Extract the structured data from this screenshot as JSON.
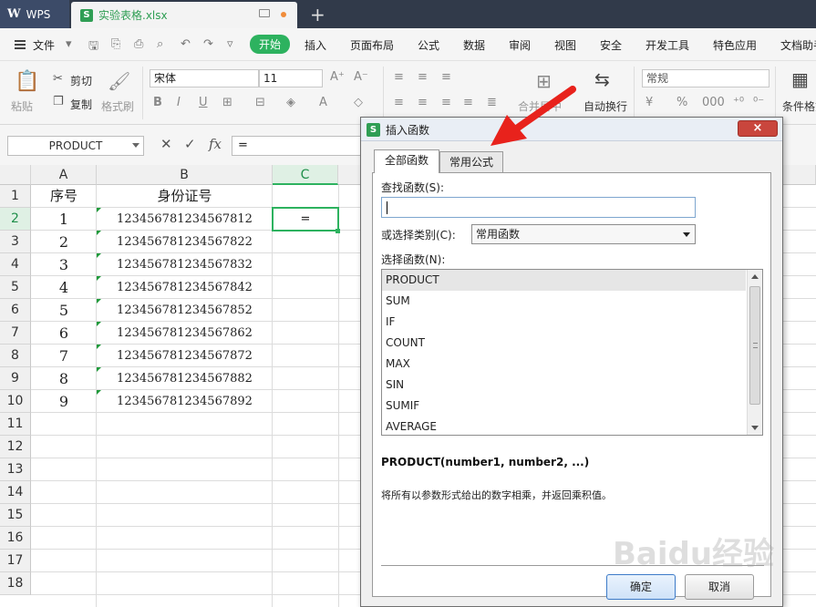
{
  "titlebar": {
    "app_name": "WPS",
    "doc_icon": "S",
    "doc_name": "实验表格.xlsx",
    "new_tab": "+"
  },
  "menubar": {
    "file": "文件",
    "tabs": [
      "开始",
      "插入",
      "页面布局",
      "公式",
      "数据",
      "审阅",
      "视图",
      "安全",
      "开发工具",
      "特色应用",
      "文档助手"
    ],
    "active_tab": "开始"
  },
  "ribbon": {
    "paste": "粘贴",
    "cut": "剪切",
    "copy": "复制",
    "format_painter": "格式刷",
    "font_name": "宋体",
    "font_size": "11",
    "wrap_text": "自动换行",
    "merge_center": "合并居中",
    "number_format": "常规",
    "conditional_format": "条件格式"
  },
  "formula_bar": {
    "name_box": "PRODUCT",
    "fx": "fx",
    "formula": "="
  },
  "sheet": {
    "columns": [
      "A",
      "B",
      "C"
    ],
    "row_numbers": [
      "1",
      "2",
      "3",
      "4",
      "5",
      "6",
      "7",
      "8",
      "9",
      "10",
      "11",
      "12",
      "13",
      "14",
      "15",
      "16",
      "17",
      "18"
    ],
    "header": [
      "序号",
      "身份证号"
    ],
    "rows": [
      [
        "1",
        "123456781234567812"
      ],
      [
        "2",
        "123456781234567822"
      ],
      [
        "3",
        "123456781234567832"
      ],
      [
        "4",
        "123456781234567842"
      ],
      [
        "5",
        "123456781234567852"
      ],
      [
        "6",
        "123456781234567862"
      ],
      [
        "7",
        "123456781234567872"
      ],
      [
        "8",
        "123456781234567882"
      ],
      [
        "9",
        "123456781234567892"
      ]
    ],
    "active_cell_value": "="
  },
  "dialog": {
    "icon": "S",
    "title": "插入函数",
    "close": "×",
    "tabs": [
      "全部函数",
      "常用公式"
    ],
    "search_label": "查找函数(S):",
    "category_label": "或选择类别(C):",
    "category_value": "常用函数",
    "func_label": "选择函数(N):",
    "functions": [
      "PRODUCT",
      "SUM",
      "IF",
      "COUNT",
      "MAX",
      "SIN",
      "SUMIF",
      "AVERAGE"
    ],
    "signature": "PRODUCT(number1, number2, ...)",
    "description": "将所有以参数形式给出的数字相乘，并返回乘积值。",
    "ok": "确定",
    "cancel": "取消"
  },
  "watermark": "Baidu经验",
  "colors": {
    "accent_green": "#2db25f",
    "arrow_red": "#e8221c"
  }
}
